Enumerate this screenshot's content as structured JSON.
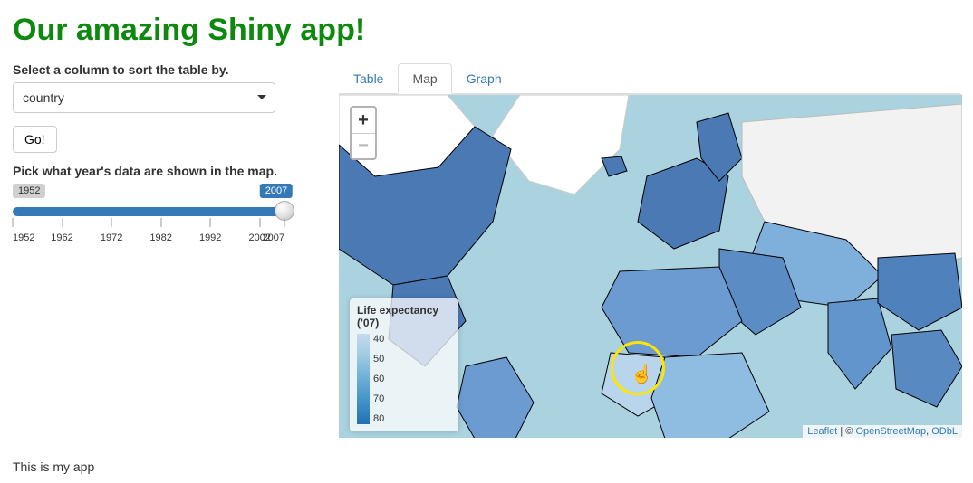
{
  "title": "Our amazing Shiny app!",
  "sidebar": {
    "select_label": "Select a column to sort the table by.",
    "select_value": "country",
    "go_button": "Go!",
    "slider_label": "Pick what year's data are shown in the map.",
    "slider": {
      "min": 1952,
      "max": 2007,
      "value": 2007,
      "ticks": [
        "1952",
        "1962",
        "1972",
        "1982",
        "1992",
        "2002",
        "2007"
      ]
    }
  },
  "tabs": [
    {
      "key": "table",
      "label": "Table",
      "active": false
    },
    {
      "key": "map",
      "label": "Map",
      "active": true
    },
    {
      "key": "graph",
      "label": "Graph",
      "active": false
    }
  ],
  "map": {
    "zoom_in": "+",
    "zoom_out": "−",
    "legend_title": "Life expectancy ('07)",
    "legend_values": [
      "40",
      "50",
      "60",
      "70",
      "80"
    ],
    "attribution_prefix": "Leaflet",
    "attribution_sep": " | © ",
    "attribution_links": [
      "OpenStreetMap",
      "ODbL"
    ]
  },
  "footer": "This is my app",
  "chart_data": {
    "type": "choropleth-map",
    "title": "Life expectancy ('07)",
    "variable": "life_expectancy",
    "year": 2007,
    "color_scale": {
      "min": 40,
      "max": 80,
      "palette": "Blues"
    },
    "legend_breaks": [
      40,
      50,
      60,
      70,
      80
    ],
    "note": "World choropleth; per-country values not individually labeled in image."
  }
}
